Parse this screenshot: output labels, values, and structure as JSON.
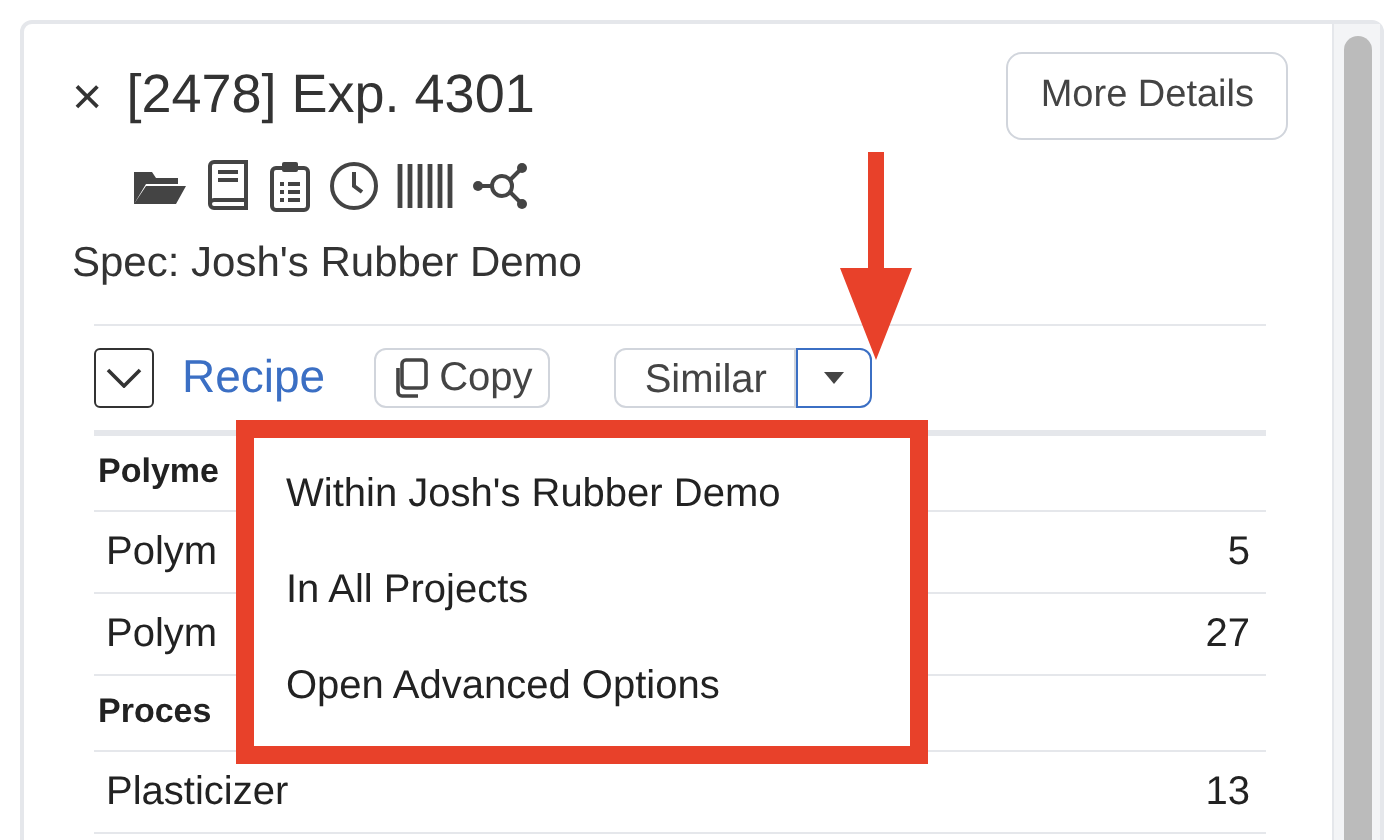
{
  "header": {
    "close": "×",
    "title": "[2478] Exp. 4301",
    "more_button": "More Details"
  },
  "spec": "Spec: Josh's Rubber Demo",
  "recipe": {
    "expanded": true,
    "title": "Recipe",
    "copy_button": "Copy",
    "similar_button": "Similar"
  },
  "table": {
    "rows": [
      {
        "kind": "group",
        "label": "Polyme"
      },
      {
        "kind": "item",
        "label": "Polym",
        "value": "5"
      },
      {
        "kind": "item",
        "label": "Polym",
        "value": "27"
      },
      {
        "kind": "group",
        "label": "Proces"
      },
      {
        "kind": "item",
        "label": "Plasticizer",
        "value": "13"
      }
    ]
  },
  "dropdown_menu": {
    "items": [
      "Within Josh's Rubber Demo",
      "In All Projects",
      "Open Advanced Options"
    ]
  }
}
